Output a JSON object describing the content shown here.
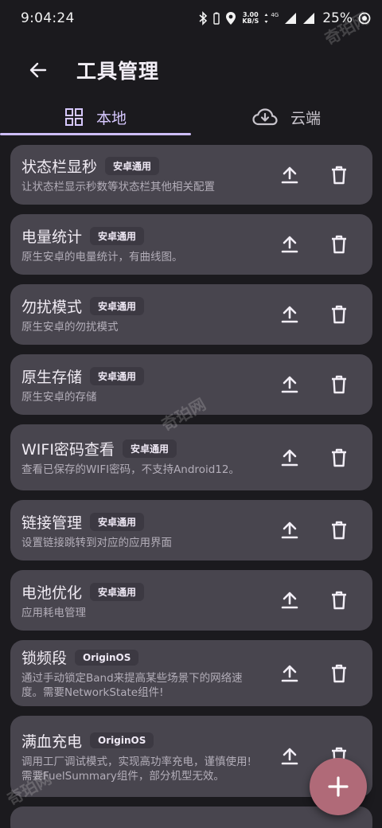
{
  "status": {
    "time": "9:04:24",
    "net_speed": "3.00",
    "net_unit": "KB/S",
    "net_type": "4G",
    "battery": "25%"
  },
  "app_bar": {
    "title": "工具管理"
  },
  "tabs": [
    {
      "label": "本地",
      "icon": "grid-icon",
      "active": true
    },
    {
      "label": "云端",
      "icon": "cloud-download-icon",
      "active": false
    }
  ],
  "tools": [
    {
      "title": "状态栏显秒",
      "badge": "安卓通用",
      "desc": "让状态栏显示秒数等状态栏其他相关配置"
    },
    {
      "title": "电量统计",
      "badge": "安卓通用",
      "desc": "原生安卓的电量统计，有曲线图。"
    },
    {
      "title": "勿扰模式",
      "badge": "安卓通用",
      "desc": "原生安卓的勿扰模式"
    },
    {
      "title": "原生存储",
      "badge": "安卓通用",
      "desc": "原生安卓的存储"
    },
    {
      "title": "WIFI密码查看",
      "badge": "安卓通用",
      "desc": "查看已保存的WIFI密码，不支持Android12。"
    },
    {
      "title": "链接管理",
      "badge": "安卓通用",
      "desc": "设置链接跳转到对应的应用界面"
    },
    {
      "title": "电池优化",
      "badge": "安卓通用",
      "desc": "应用耗电管理"
    },
    {
      "title": "锁频段",
      "badge": "OriginOS",
      "desc": "通过手动锁定Band来提高某些场景下的网络速度。需要NetworkState组件!"
    },
    {
      "title": "满血充电",
      "badge": "OriginOS",
      "desc": "调用工厂调试模式，实现高功率充电，谨慎使用! 需要FuelSummary组件，部分机型无效。"
    }
  ],
  "watermark": "奇珀网"
}
